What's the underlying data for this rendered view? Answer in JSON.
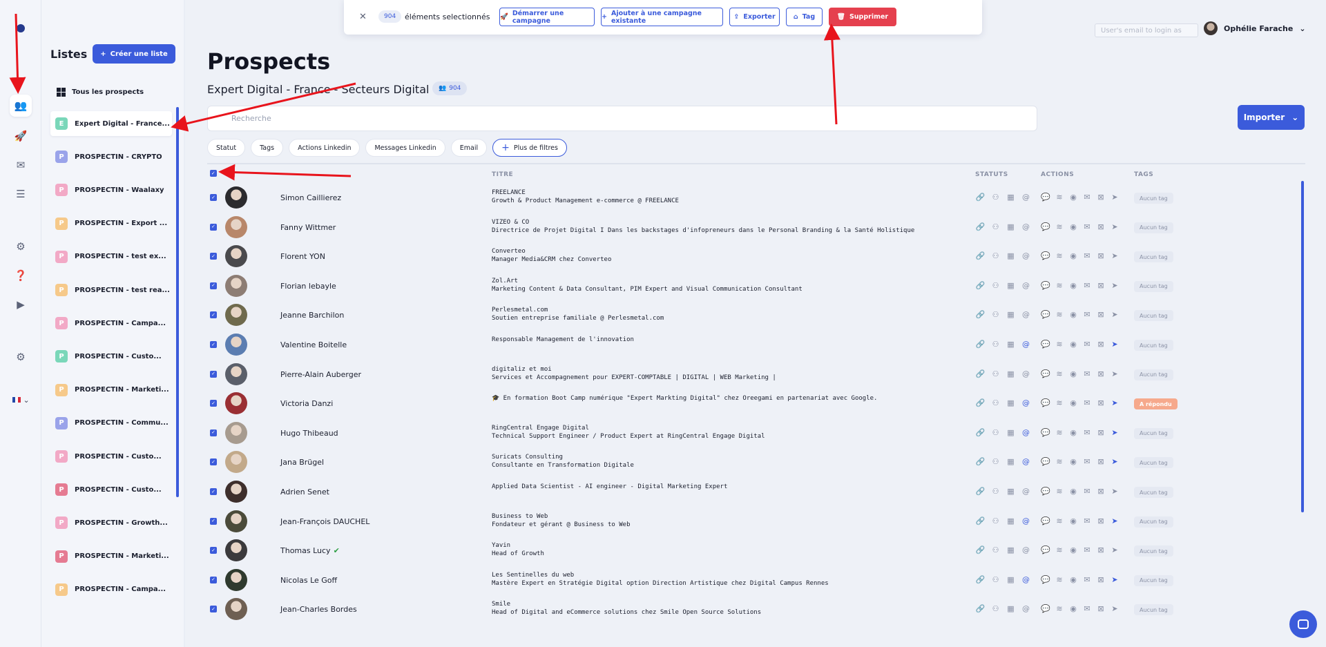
{
  "rail": {
    "icons": [
      "logo-dot",
      "users-icon",
      "rocket-icon",
      "mail-icon",
      "list-icon",
      "gear-icon",
      "help-icon",
      "play-icon",
      "settings-icon",
      "flag-icon"
    ]
  },
  "lists": {
    "heading": "Listes",
    "create_label": "Créer une liste",
    "all_label": "Tous les prospects",
    "items": [
      {
        "letter": "E",
        "label": "Expert Digital - France...",
        "color": "#7ad7b9"
      },
      {
        "letter": "P",
        "label": "PROSPECTIN - CRYPTO",
        "color": "#9aa3ea"
      },
      {
        "letter": "P",
        "label": "PROSPECTIN - Waalaxy",
        "color": "#f2a9c6"
      },
      {
        "letter": "P",
        "label": "PROSPECTIN - Export ...",
        "color": "#f6c98a"
      },
      {
        "letter": "P",
        "label": "PROSPECTIN - test ex...",
        "color": "#f2a9c6"
      },
      {
        "letter": "P",
        "label": "PROSPECTIN - test rea...",
        "color": "#f6c98a"
      },
      {
        "letter": "P",
        "label": "PROSPECTIN - Campa...",
        "color": "#f2a9c6"
      },
      {
        "letter": "P",
        "label": "PROSPECTIN - Custo...",
        "color": "#7ad7b9"
      },
      {
        "letter": "P",
        "label": "PROSPECTIN - Marketi...",
        "color": "#f6c98a"
      },
      {
        "letter": "P",
        "label": "PROSPECTIN - Commu...",
        "color": "#9aa3ea"
      },
      {
        "letter": "P",
        "label": "PROSPECTIN - Custo...",
        "color": "#f2a9c6"
      },
      {
        "letter": "P",
        "label": "PROSPECTIN - Custo...",
        "color": "#e57b92"
      },
      {
        "letter": "P",
        "label": "PROSPECTIN - Growth...",
        "color": "#f2a9c6"
      },
      {
        "letter": "P",
        "label": "PROSPECTIN - Marketi...",
        "color": "#e57b92"
      },
      {
        "letter": "P",
        "label": "PROSPECTIN - Campa...",
        "color": "#f6c98a"
      }
    ]
  },
  "selection": {
    "count": "904",
    "label": "éléments selectionnés",
    "buttons": {
      "start": "Démarrer une campagne",
      "add": "Ajouter à une campagne existante",
      "export": "Exporter",
      "tag": "Tag",
      "delete": "Supprimer"
    }
  },
  "topright": {
    "email_placeholder": "User's email to login as",
    "user_name": "Ophélie Farache"
  },
  "main": {
    "title": "Prospects",
    "subtitle": "Expert Digital - France - Secteurs Digital",
    "count": "904",
    "search_placeholder": "Recherche",
    "import_label": "Importer",
    "filters": [
      "Statut",
      "Tags",
      "Actions Linkedin",
      "Messages Linkedin",
      "Email"
    ],
    "more_filters": "Plus de filtres",
    "columns": {
      "title": "TITRE",
      "statuses": "STATUTS",
      "actions": "ACTIONS",
      "tags": "TAGS"
    }
  },
  "prospects": [
    {
      "name": "Simon Caillierez",
      "title1": "FREELANCE",
      "title2": "Growth & Product Management e-commerce @ FREELANCE",
      "status": "orange",
      "tag": "Aucun tag",
      "avatar": "#2b2b2e"
    },
    {
      "name": "Fanny Wittmer",
      "title1": "VIZEO & CO",
      "title2": "Directrice de Projet Digital I Dans les backstages d'infopreneurs dans le Personal Branding & la Santé Holistique",
      "status": "orange",
      "tag": "Aucun tag",
      "avatar": "#b8876a"
    },
    {
      "name": "Florent YON",
      "title1": "Converteo",
      "title2": "Manager Media&CRM chez Converteo",
      "status": "orange",
      "tag": "Aucun tag",
      "avatar": "#4a4a4d"
    },
    {
      "name": "Florian lebayle",
      "title1": "Zol.Art",
      "title2": "Marketing Content & Data Consultant, PIM Expert and Visual Communication Consultant",
      "status": "orange",
      "tag": "Aucun tag",
      "avatar": "#8d7d74"
    },
    {
      "name": "Jeanne Barchilon",
      "title1": "Perlesmetal.com",
      "title2": "Soutien entreprise familiale @ Perlesmetal.com",
      "status": "orange",
      "tag": "Aucun tag",
      "avatar": "#6f6a4d"
    },
    {
      "name": "Valentine Boitelle",
      "title1": "Responsable Management de l'innovation",
      "title2": "",
      "status": "blue",
      "tag": "Aucun tag",
      "avatar": "#5b7db1"
    },
    {
      "name": "Pierre-Alain Auberger",
      "title1": "digitaliz et moi",
      "title2": "Services et Accompagnement pour EXPERT-COMPTABLE | DIGITAL | WEB Marketing |",
      "status": "orange",
      "tag": "Aucun tag",
      "avatar": "#5a5f6a"
    },
    {
      "name": "Victoria Danzi",
      "title1": "🎓 En formation Boot Camp numérique \"Expert Markting Digital\" chez Oreegami en partenariat avec Google.",
      "title2": "",
      "status": "blue",
      "tag": "A répondu",
      "tag_style": "warn",
      "avatar": "#9a2f34"
    },
    {
      "name": "Hugo Thibeaud",
      "title1": "RingCentral Engage Digital",
      "title2": "Technical Support Engineer / Product Expert at RingCentral Engage Digital",
      "status": "blue",
      "tag": "Aucun tag",
      "avatar": "#a79b8f"
    },
    {
      "name": "Jana Brügel",
      "title1": "Suricats Consulting",
      "title2": "Consultante en Transformation Digitale",
      "status": "blue",
      "tag": "Aucun tag",
      "avatar": "#c2a98a"
    },
    {
      "name": "Adrien Senet",
      "title1": "Applied Data Scientist - AI engineer - Digital Marketing Expert",
      "title2": "",
      "status": "orange",
      "tag": "Aucun tag",
      "avatar": "#3e2f2c"
    },
    {
      "name": "Jean-François DAUCHEL",
      "title1": "Business to Web",
      "title2": "Fondateur et gérant @ Business to Web",
      "status": "blue",
      "tag": "Aucun tag",
      "avatar": "#4b4b3a"
    },
    {
      "name": "Thomas Lucy",
      "verified": "✔",
      "title1": "Yavin",
      "title2": "Head of Growth",
      "status": "orange",
      "tag": "Aucun tag",
      "avatar": "#3b3a3c"
    },
    {
      "name": "Nicolas Le Goff",
      "title1": "Les Sentinelles du web",
      "title2": "Mastère Expert en Stratégie Digital option Direction Artistique chez Digital Campus Rennes",
      "status": "blue",
      "tag": "Aucun tag",
      "avatar": "#2f3a2e"
    },
    {
      "name": "Jean-Charles Bordes",
      "title1": "Smile",
      "title2": "Head of Digital and eCommerce solutions chez Smile Open Source Solutions",
      "status": "orange",
      "tag": "Aucun tag",
      "avatar": "#6e5f52"
    }
  ]
}
